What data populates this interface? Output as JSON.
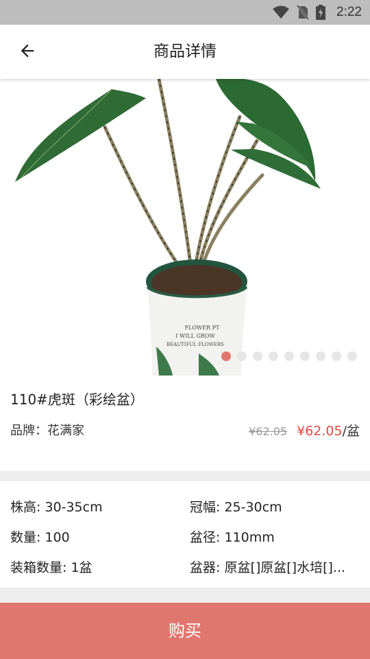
{
  "status_bar": {
    "time": "2:22"
  },
  "toolbar": {
    "title": "商品详情"
  },
  "gallery": {
    "page_count": 9,
    "active_index": 0,
    "pot_text": [
      "FLOWER PT",
      "I WILL GROW",
      "BEAUTIFUL FLOWERS"
    ]
  },
  "product": {
    "name": "110#虎斑（彩绘盆）",
    "brand_label": "品牌：",
    "brand": "花满家",
    "old_price": "¥62.05",
    "price": "¥62.05",
    "unit": "/盆"
  },
  "specs": {
    "height": "株高: 30-35cm",
    "crown": "冠幅: 25-30cm",
    "quantity": "数量: 100",
    "pot_diameter": "盆径: 110mm",
    "box_quantity": "装箱数量: 1盆",
    "container": "盆器: 原盆[]原盆[]水培[]..."
  },
  "actions": {
    "buy_label": "购买"
  },
  "colors": {
    "accent": "#e0776f",
    "price": "#e4473e",
    "status_bar": "#bdbdbd"
  }
}
